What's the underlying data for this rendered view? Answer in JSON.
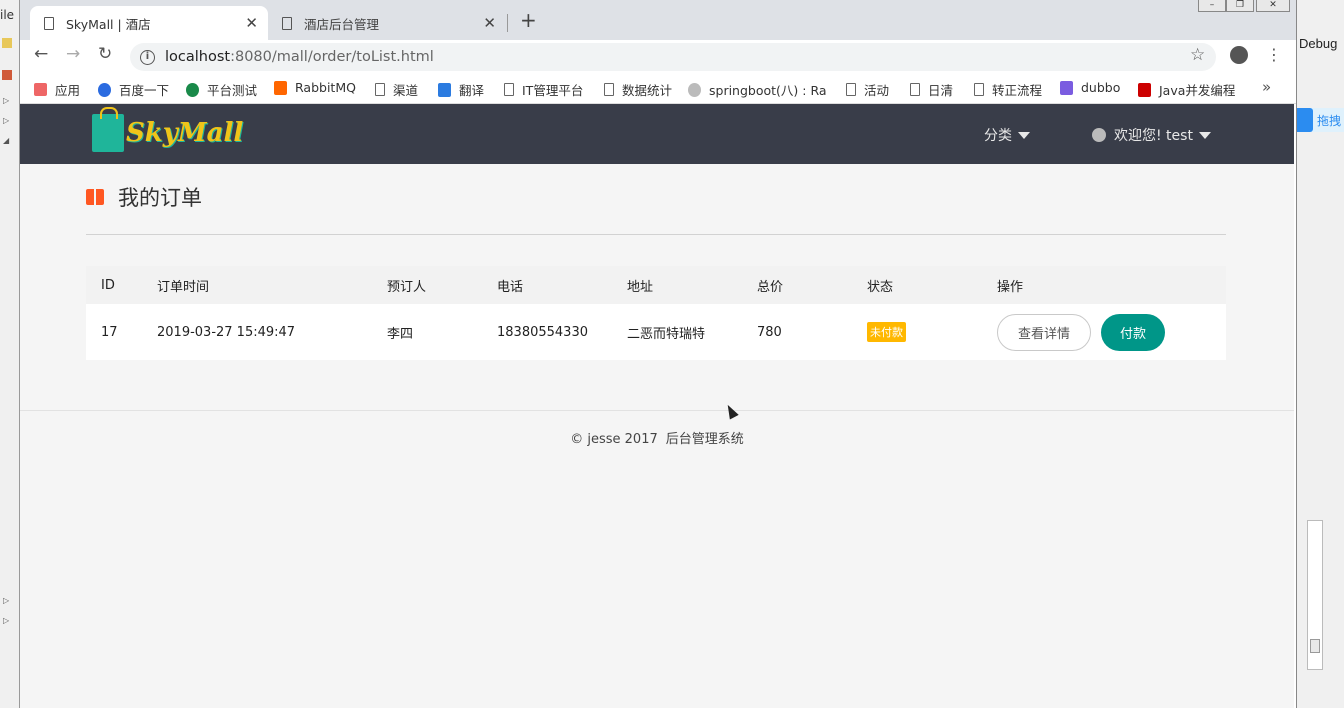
{
  "ide": {
    "left_label": "ile",
    "right_label": "Debug",
    "baidu_label": "拖拽"
  },
  "browser": {
    "tabs": [
      {
        "title": "SkyMall | 酒店",
        "active": true
      },
      {
        "title": "酒店后台管理",
        "active": false
      }
    ],
    "url_host": "localhost",
    "url_path": ":8080/mall/order/toList.html",
    "bookmarks": [
      "应用",
      "百度一下",
      "平台测试",
      "RabbitMQ",
      "渠道",
      "翻译",
      "IT管理平台",
      "数据统计",
      "springboot(八) : Ra",
      "活动",
      "日清",
      "转正流程",
      "dubbo",
      "Java并发编程"
    ]
  },
  "site": {
    "logo_text": "SkyMall",
    "nav_category": "分类",
    "nav_user": "欢迎您! test"
  },
  "page": {
    "title": "我的订单"
  },
  "orders": {
    "headers": [
      "ID",
      "订单时间",
      "预订人",
      "电话",
      "地址",
      "总价",
      "状态",
      "操作"
    ],
    "rows": [
      {
        "id": "17",
        "time": "2019-03-27 15:49:47",
        "person": "李四",
        "phone": "18380554330",
        "address": "二恶而特瑞特",
        "total": "780",
        "status": "未付款",
        "detail_label": "查看详情",
        "pay_label": "付款"
      }
    ]
  },
  "footer": {
    "copyright": "© jesse 2017",
    "system": "后台管理系统"
  },
  "colors": {
    "navbar": "#393d49",
    "primary": "#009688",
    "warning": "#ffb800",
    "logo": "#f0c419"
  }
}
